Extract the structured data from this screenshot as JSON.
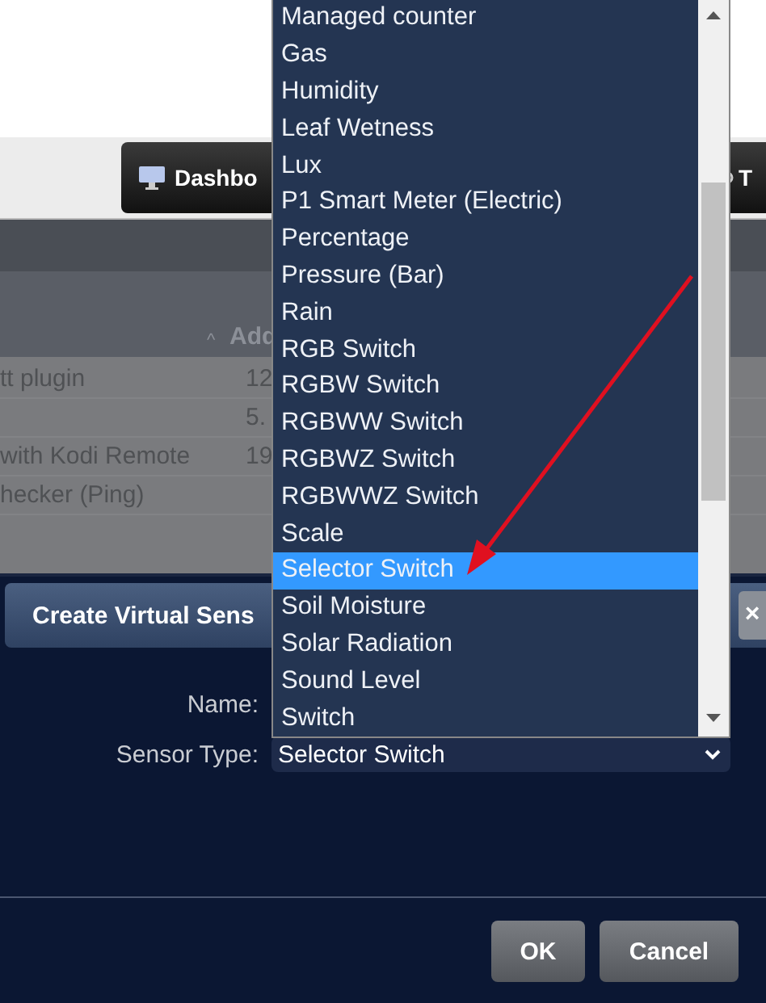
{
  "nav": {
    "dashboard_button": "Dashbo",
    "right_tab": "T"
  },
  "table": {
    "header": "Add",
    "sort_indicator": "^",
    "rows": [
      {
        "name": "tt plugin",
        "value": "12"
      },
      {
        "name": "",
        "value": "5."
      },
      {
        "name": "with Kodi Remote",
        "value": "19"
      },
      {
        "name": "hecker (Ping)",
        "value": ""
      }
    ]
  },
  "dialog": {
    "title": "Create Virtual Sens",
    "close": "×",
    "name_label": "Name:",
    "type_label": "Sensor Type:",
    "type_value": "Selector Switch",
    "buttons": [
      "OK",
      "Cancel"
    ]
  },
  "dropdown": {
    "options": [
      {
        "label": "Managed counter",
        "selected": false
      },
      {
        "label": "Gas",
        "selected": false
      },
      {
        "label": "Humidity",
        "selected": false
      },
      {
        "label": "Leaf Wetness",
        "selected": false
      },
      {
        "label": "Lux",
        "selected": false
      },
      {
        "label": "P1 Smart Meter (Electric)",
        "selected": false
      },
      {
        "label": "Percentage",
        "selected": false
      },
      {
        "label": "Pressure (Bar)",
        "selected": false
      },
      {
        "label": "Rain",
        "selected": false
      },
      {
        "label": "RGB Switch",
        "selected": false
      },
      {
        "label": "RGBW Switch",
        "selected": false
      },
      {
        "label": "RGBWW Switch",
        "selected": false
      },
      {
        "label": "RGBWZ Switch",
        "selected": false
      },
      {
        "label": "RGBWWZ Switch",
        "selected": false
      },
      {
        "label": "Scale",
        "selected": false
      },
      {
        "label": "Selector Switch",
        "selected": true
      },
      {
        "label": "Soil Moisture",
        "selected": false
      },
      {
        "label": "Solar Radiation",
        "selected": false
      },
      {
        "label": "Sound Level",
        "selected": false
      },
      {
        "label": "Switch",
        "selected": false
      }
    ]
  }
}
